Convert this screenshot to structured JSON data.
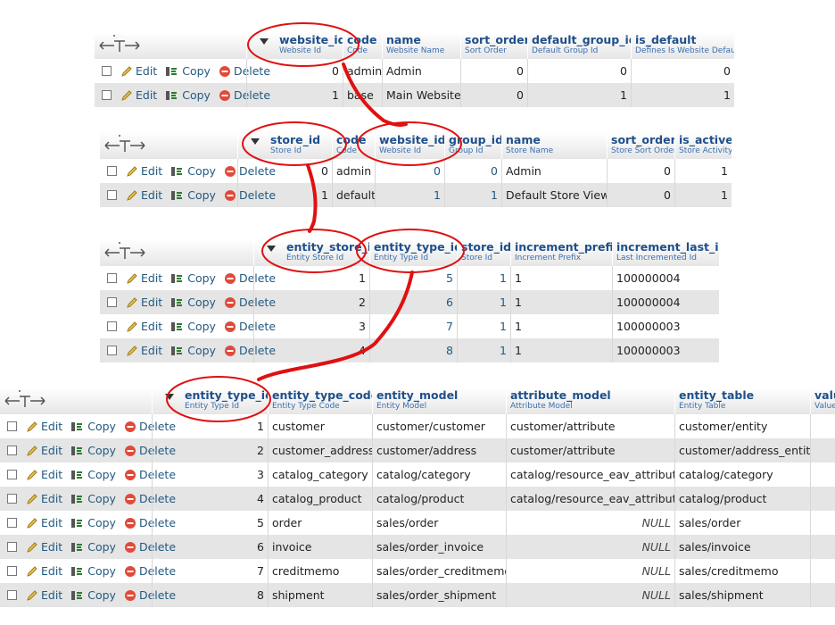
{
  "actions": {
    "edit": "Edit",
    "copy": "Copy",
    "delete": "Delete",
    "null_text": "NULL"
  },
  "colors": {
    "header_text": "#1f4f8a",
    "link": "#235a81",
    "annotation_red": "#e01010",
    "row_alt": "#e5e5e5"
  },
  "website_table": {
    "columns": [
      {
        "name": "website_id",
        "comment": "Website Id"
      },
      {
        "name": "code",
        "comment": "Code"
      },
      {
        "name": "name",
        "comment": "Website Name"
      },
      {
        "name": "sort_order",
        "comment": "Sort Order"
      },
      {
        "name": "default_group_id",
        "comment": "Default Group Id"
      },
      {
        "name": "is_default",
        "comment": "Defines Is Website Default"
      }
    ],
    "rows": [
      [
        "0",
        "admin",
        "Admin",
        "0",
        "0",
        "0"
      ],
      [
        "1",
        "base",
        "Main Website",
        "0",
        "1",
        "1"
      ]
    ]
  },
  "store_table": {
    "columns": [
      {
        "name": "store_id",
        "comment": "Store Id"
      },
      {
        "name": "code",
        "comment": "Code"
      },
      {
        "name": "website_id",
        "comment": "Website Id"
      },
      {
        "name": "group_id",
        "comment": "Group Id"
      },
      {
        "name": "name",
        "comment": "Store Name"
      },
      {
        "name": "sort_order",
        "comment": "Store Sort Order"
      },
      {
        "name": "is_active",
        "comment": "Store Activity"
      }
    ],
    "rows": [
      [
        "0",
        "admin",
        "0",
        "0",
        "Admin",
        "0",
        "1"
      ],
      [
        "1",
        "default",
        "1",
        "1",
        "Default Store View",
        "0",
        "1"
      ]
    ]
  },
  "entity_store_table": {
    "columns": [
      {
        "name": "entity_store_id",
        "comment": "Entity Store Id"
      },
      {
        "name": "entity_type_id",
        "comment": "Entity Type Id"
      },
      {
        "name": "store_id",
        "comment": "Store Id"
      },
      {
        "name": "increment_prefix",
        "comment": "Increment Prefix"
      },
      {
        "name": "increment_last_id",
        "comment": "Last Incremented Id"
      }
    ],
    "rows": [
      [
        "1",
        "5",
        "1",
        "1",
        "100000004"
      ],
      [
        "2",
        "6",
        "1",
        "1",
        "100000004"
      ],
      [
        "3",
        "7",
        "1",
        "1",
        "100000003"
      ],
      [
        "4",
        "8",
        "1",
        "1",
        "100000003"
      ]
    ]
  },
  "entity_type_table": {
    "columns": [
      {
        "name": "entity_type_id",
        "comment": "Entity Type Id"
      },
      {
        "name": "entity_type_code",
        "comment": "Entity Type Code"
      },
      {
        "name": "entity_model",
        "comment": "Entity Model"
      },
      {
        "name": "attribute_model",
        "comment": "Attribute Model"
      },
      {
        "name": "entity_table",
        "comment": "Entity Table"
      },
      {
        "name": "valu",
        "comment": "Value"
      }
    ],
    "rows": [
      [
        "1",
        "customer",
        "customer/customer",
        "customer/attribute",
        "customer/entity",
        ""
      ],
      [
        "2",
        "customer_address",
        "customer/address",
        "customer/attribute",
        "customer/address_entity",
        ""
      ],
      [
        "3",
        "catalog_category",
        "catalog/category",
        "catalog/resource_eav_attribute",
        "catalog/category",
        ""
      ],
      [
        "4",
        "catalog_product",
        "catalog/product",
        "catalog/resource_eav_attribute",
        "catalog/product",
        ""
      ],
      [
        "5",
        "order",
        "sales/order",
        "NULL",
        "sales/order",
        ""
      ],
      [
        "6",
        "invoice",
        "sales/order_invoice",
        "NULL",
        "sales/invoice",
        ""
      ],
      [
        "7",
        "creditmemo",
        "sales/order_creditmemo",
        "NULL",
        "sales/creditmemo",
        ""
      ],
      [
        "8",
        "shipment",
        "sales/order_shipment",
        "NULL",
        "sales/shipment",
        ""
      ]
    ]
  }
}
